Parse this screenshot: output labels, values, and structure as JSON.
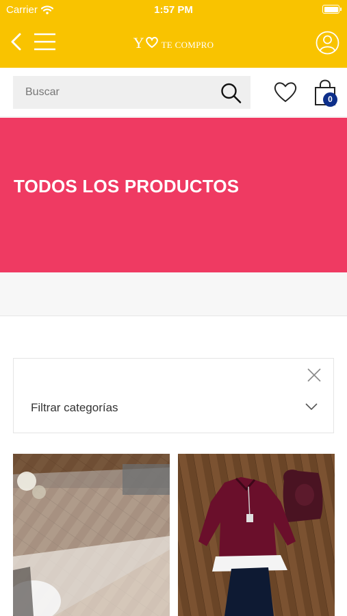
{
  "status_bar": {
    "carrier": "Carrier",
    "time": "1:57 PM"
  },
  "header": {
    "logo_main": "Y",
    "logo_tagline": "TE COMPRO",
    "colors": {
      "background": "#f9c300",
      "foreground": "#ffffff"
    },
    "icons": [
      "back-icon",
      "menu-icon",
      "heart-logo-icon",
      "account-icon"
    ]
  },
  "search": {
    "placeholder": "Buscar",
    "value": ""
  },
  "cart": {
    "count": "0",
    "badge_color": "#0d2f8a"
  },
  "hero": {
    "title": "TODOS LOS PRODUCTOS",
    "color": "#ef3a62"
  },
  "filter": {
    "label": "Filtrar categorías"
  },
  "products": [
    {
      "image": "product-photo-glass-table"
    },
    {
      "image": "product-photo-maroon-top-outfit"
    }
  ]
}
